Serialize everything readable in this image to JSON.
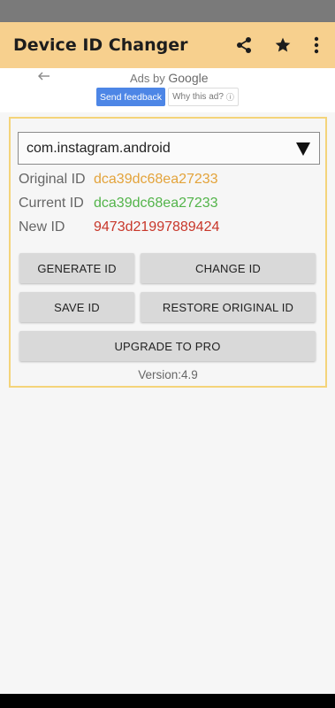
{
  "app": {
    "title": "Device ID Changer",
    "icons": [
      "share-icon",
      "star-icon",
      "more-vert-icon"
    ]
  },
  "ad": {
    "ads_by": "Ads by",
    "google": "Google",
    "send_feedback": "Send feedback",
    "why_this_ad": "Why this ad?",
    "info_glyph": "ⓘ"
  },
  "package": {
    "selected": "com.instagram.android"
  },
  "ids": {
    "original_label": "Original ID",
    "original_value": "dca39dc68ea27233",
    "current_label": "Current ID",
    "current_value": "dca39dc68ea27233",
    "new_label": "New ID",
    "new_value": "9473d21997889424"
  },
  "buttons": {
    "generate": "GENERATE ID",
    "change": "CHANGE ID",
    "save": "SAVE ID",
    "restore": "RESTORE ORIGINAL ID",
    "upgrade": "UPGRADE TO PRO"
  },
  "version": "Version:4.9",
  "colors": {
    "app_bar": "#f7d08e",
    "panel_border": "#f4d47a",
    "original_id": "#e3a33a",
    "current_id": "#53b44a",
    "new_id": "#c8372a",
    "feedback_button": "#4d86e6"
  }
}
